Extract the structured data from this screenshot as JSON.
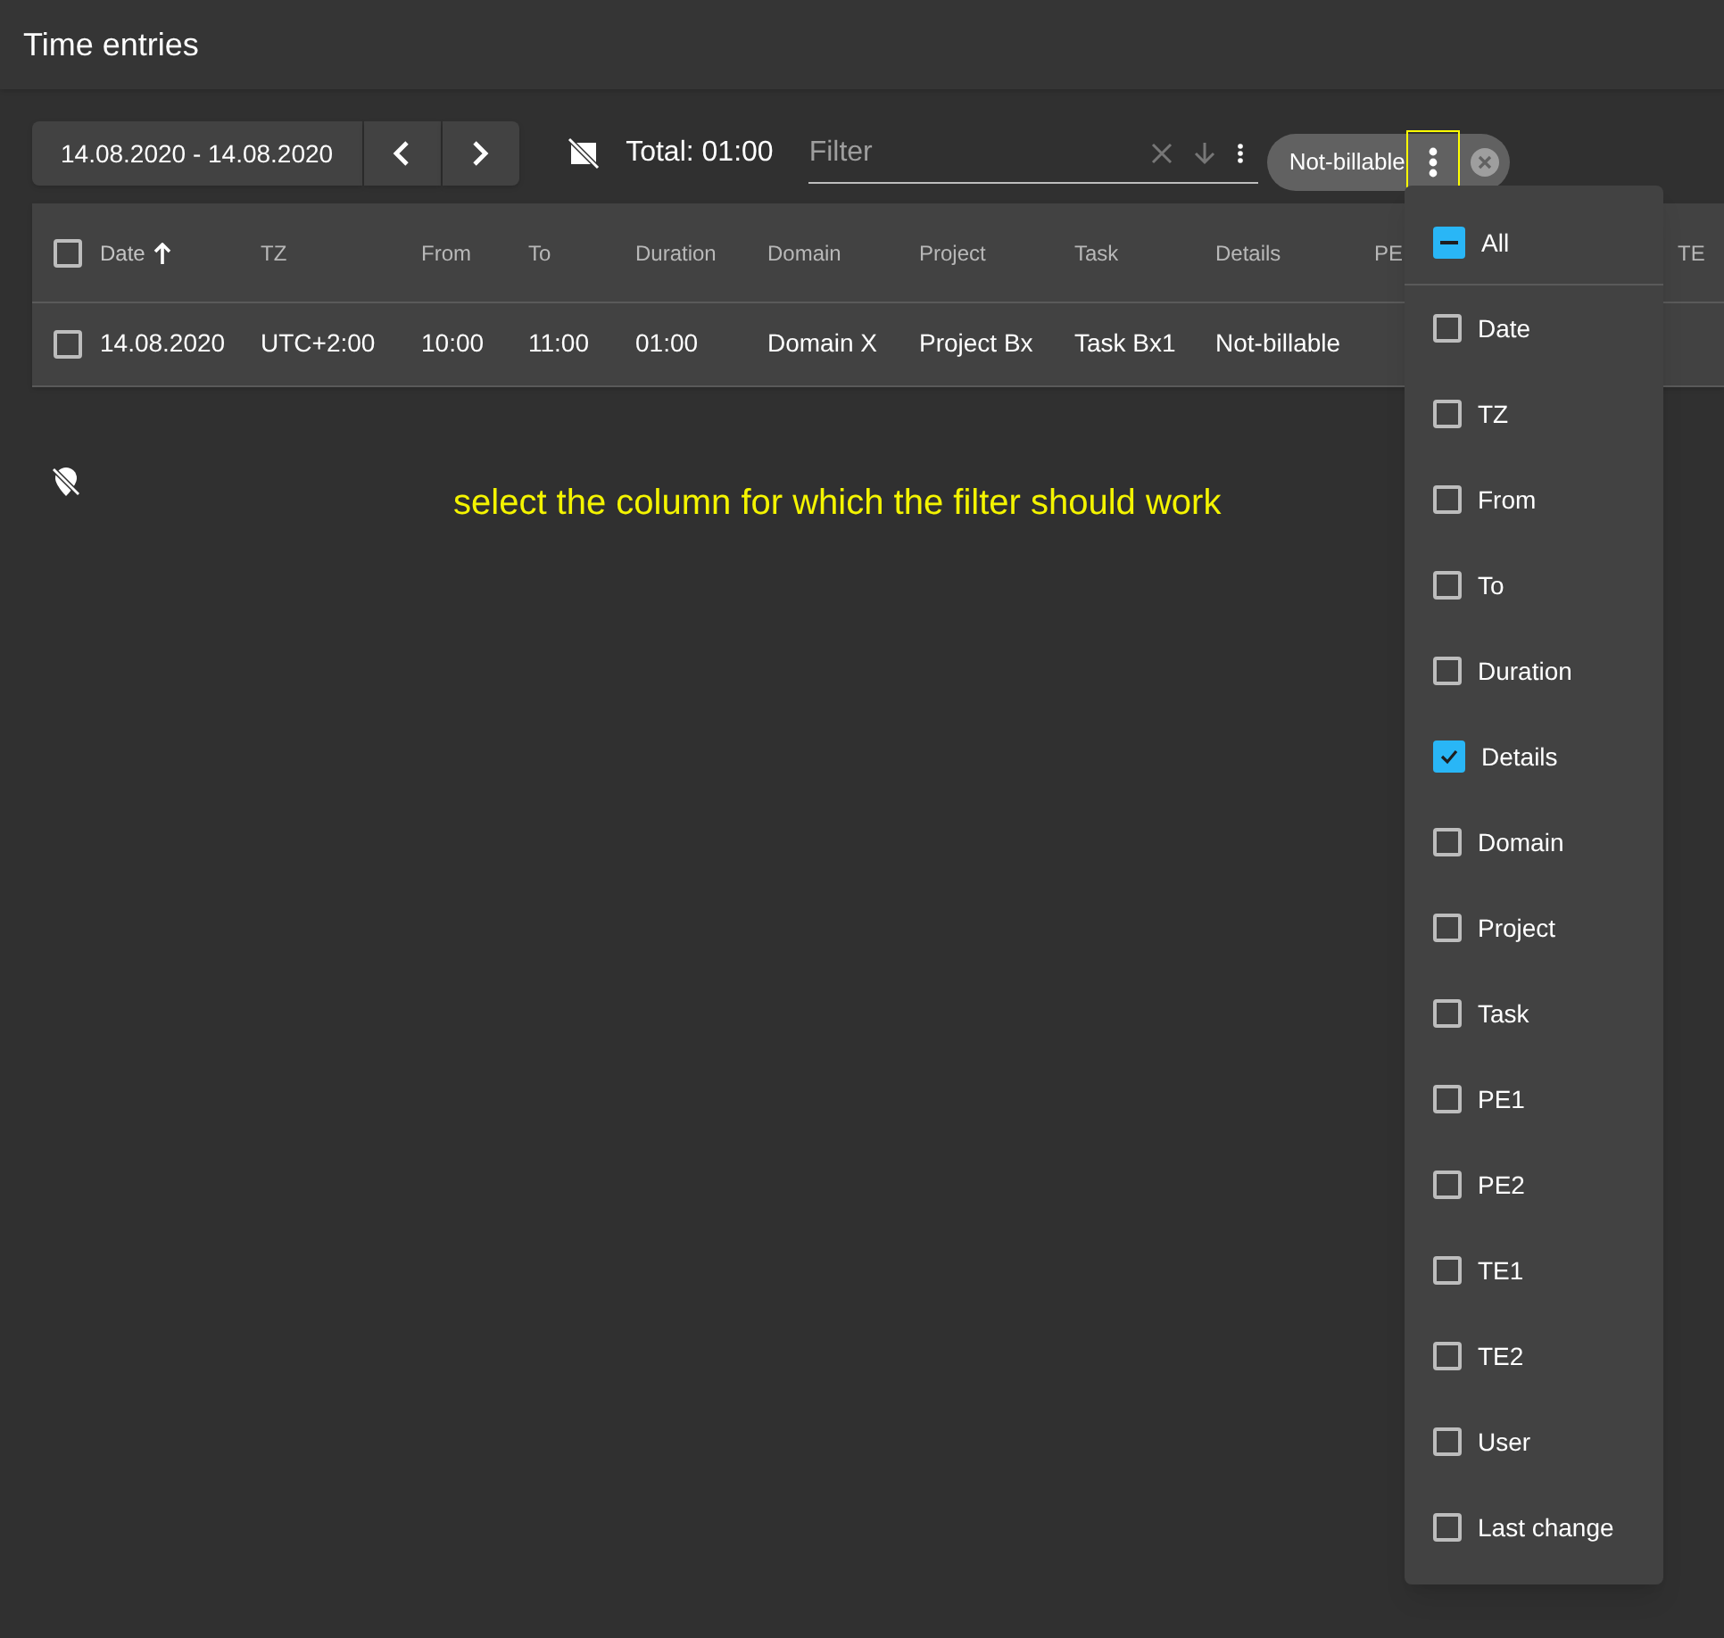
{
  "title": "Time entries",
  "toolbar": {
    "date_range": "14.08.2020 - 14.08.2020",
    "total": "Total: 01:00",
    "filter": {
      "placeholder": "Filter"
    },
    "chip": {
      "label": "Not-billable"
    }
  },
  "table": {
    "select_all_checked": false,
    "columns": [
      {
        "label": "Date",
        "sorted": true
      },
      {
        "label": "TZ",
        "sorted": false
      },
      {
        "label": "From",
        "sorted": false
      },
      {
        "label": "To",
        "sorted": false
      },
      {
        "label": "Duration",
        "sorted": false
      },
      {
        "label": "Domain",
        "sorted": false
      },
      {
        "label": "Project",
        "sorted": false
      },
      {
        "label": "Task",
        "sorted": false
      },
      {
        "label": "Details",
        "sorted": false
      },
      {
        "label": "PE",
        "sorted": false
      },
      {
        "label": "TE",
        "sorted": false
      }
    ],
    "rows": [
      {
        "checked": false,
        "cells": [
          "14.08.2020",
          "UTC+2:00",
          "10:00",
          "11:00",
          "01:00",
          "Domain X",
          "Project Bx",
          "Task Bx1",
          "Not-billable"
        ]
      }
    ]
  },
  "hint": "select the column for which the filter should work",
  "column_menu": [
    {
      "label": "All",
      "checked": false,
      "indeterminate": true
    },
    {
      "label": "Date",
      "checked": false,
      "indeterminate": false
    },
    {
      "label": "TZ",
      "checked": false,
      "indeterminate": false
    },
    {
      "label": "From",
      "checked": false,
      "indeterminate": false
    },
    {
      "label": "To",
      "checked": false,
      "indeterminate": false
    },
    {
      "label": "Duration",
      "checked": false,
      "indeterminate": false
    },
    {
      "label": "Details",
      "checked": true,
      "indeterminate": false
    },
    {
      "label": "Domain",
      "checked": false,
      "indeterminate": false
    },
    {
      "label": "Project",
      "checked": false,
      "indeterminate": false
    },
    {
      "label": "Task",
      "checked": false,
      "indeterminate": false
    },
    {
      "label": "PE1",
      "checked": false,
      "indeterminate": false
    },
    {
      "label": "PE2",
      "checked": false,
      "indeterminate": false
    },
    {
      "label": "TE1",
      "checked": false,
      "indeterminate": false
    },
    {
      "label": "TE2",
      "checked": false,
      "indeterminate": false
    },
    {
      "label": "User",
      "checked": false,
      "indeterminate": false
    },
    {
      "label": "Last change",
      "checked": false,
      "indeterminate": false
    }
  ]
}
